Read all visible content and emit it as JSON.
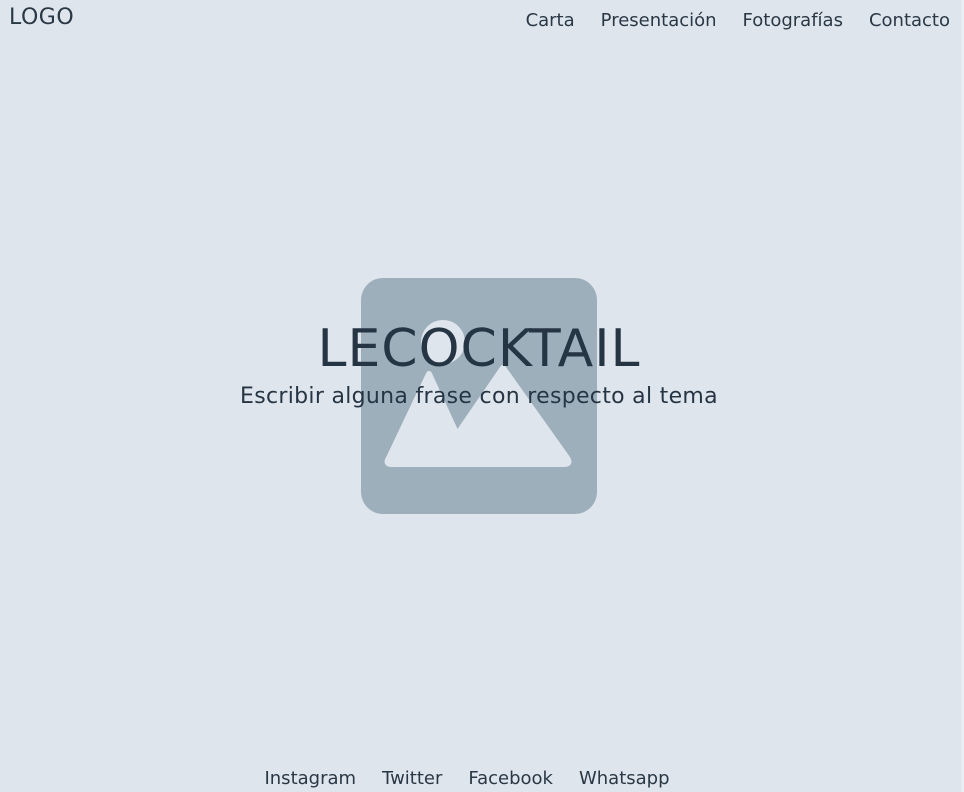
{
  "header": {
    "logo": "LOGO",
    "nav": [
      {
        "label": "Carta"
      },
      {
        "label": "Presentación"
      },
      {
        "label": "Fotografías"
      },
      {
        "label": "Contacto"
      }
    ]
  },
  "hero": {
    "image_icon": "image-placeholder-icon",
    "title": "LECOCKTAIL",
    "subtitle": "Escribir alguna frase con respecto al tema"
  },
  "footer": {
    "links": [
      {
        "label": "Instagram"
      },
      {
        "label": "Twitter"
      },
      {
        "label": "Facebook"
      },
      {
        "label": "Whatsapp"
      }
    ]
  },
  "colors": {
    "background": "#dfe5ed",
    "text": "#2a3846",
    "placeholder": "#9eafbc"
  }
}
